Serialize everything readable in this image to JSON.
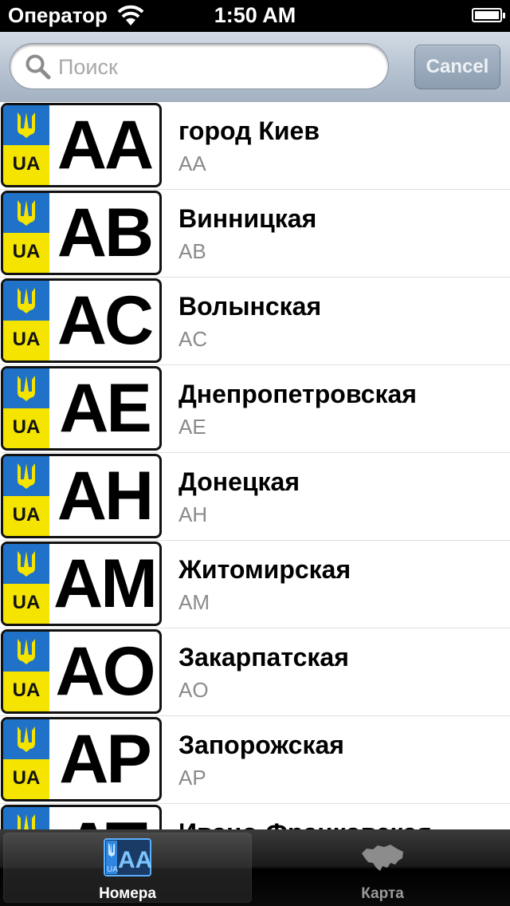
{
  "status_bar": {
    "carrier": "Оператор",
    "time": "1:50 AM"
  },
  "search": {
    "placeholder": "Поиск",
    "value": "",
    "cancel_label": "Cancel"
  },
  "plate": {
    "country": "UA",
    "colors": {
      "blue": "#1f72c8",
      "yellow": "#f5e400"
    }
  },
  "regions": [
    {
      "name": "город Киев",
      "code": "AA"
    },
    {
      "name": "Винницкая",
      "code": "AB"
    },
    {
      "name": "Волынская",
      "code": "AC"
    },
    {
      "name": "Днепропетровская",
      "code": "AE"
    },
    {
      "name": "Донецкая",
      "code": "AH"
    },
    {
      "name": "Житомирская",
      "code": "AM"
    },
    {
      "name": "Закарпатская",
      "code": "AO"
    },
    {
      "name": "Запорожская",
      "code": "AP"
    },
    {
      "name": "Ивано-Франковская",
      "code": "AT"
    }
  ],
  "tab_bar": {
    "tabs": [
      {
        "label": "Номера",
        "icon": "plate-icon",
        "active": true
      },
      {
        "label": "Карта",
        "icon": "ukraine-map-icon",
        "active": false
      }
    ]
  }
}
